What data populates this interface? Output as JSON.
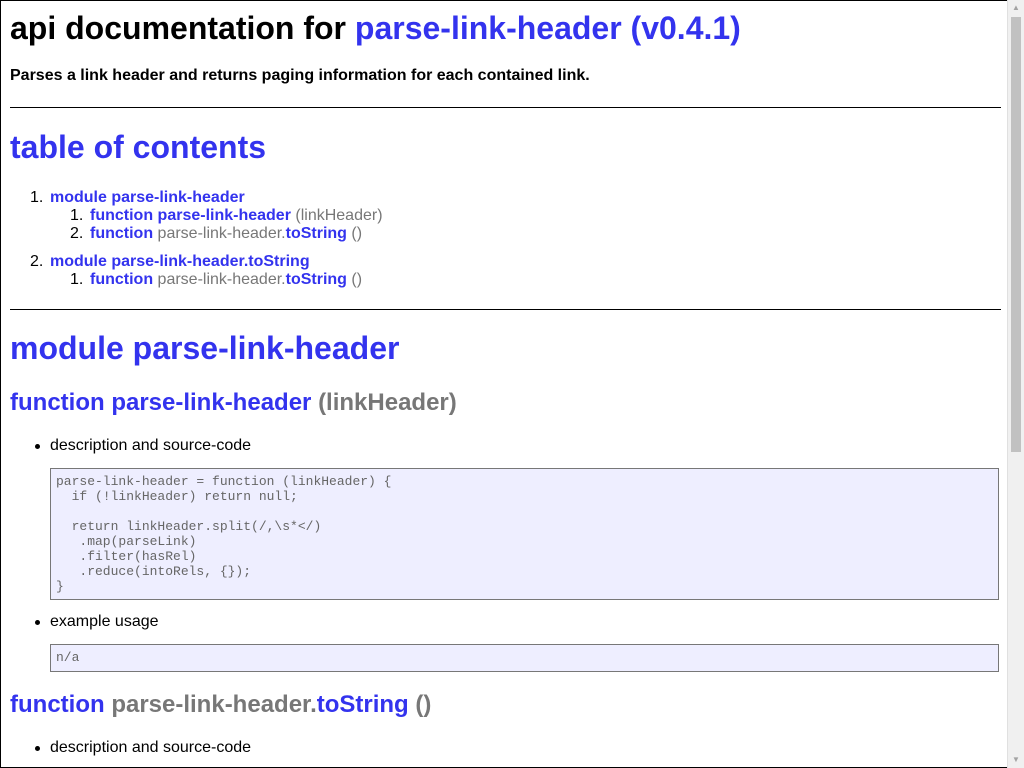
{
  "header": {
    "title_prefix": "api documentation for ",
    "title_link": "parse-link-header (v0.4.1)",
    "description": "Parses a link header and returns paging information for each contained link."
  },
  "toc": {
    "heading": "table of contents",
    "items": [
      {
        "num": "1.",
        "label": "module parse-link-header",
        "children": [
          {
            "num": "1.",
            "kw": "function",
            "name_link": "parse-link-header",
            "name_plain": "",
            "sig": "(linkHeader)"
          },
          {
            "num": "2.",
            "kw": "function",
            "name_plain": "parse-link-header.",
            "name_link": "toString",
            "sig": "()"
          }
        ]
      },
      {
        "num": "2.",
        "label": "module parse-link-header.toString",
        "children": [
          {
            "num": "1.",
            "kw": "function",
            "name_plain": "parse-link-header.",
            "name_link": "toString",
            "sig": "()"
          }
        ]
      }
    ]
  },
  "module": {
    "heading": "module parse-link-header",
    "functions": [
      {
        "kw": "function",
        "name_link": "parse-link-header",
        "sig": "(linkHeader)",
        "desc_label": "description and source-code",
        "source": "parse-link-header = function (linkHeader) {\n  if (!linkHeader) return null;\n\n  return linkHeader.split(/,\\s*</)\n   .map(parseLink)\n   .filter(hasRel)\n   .reduce(intoRels, {});\n}",
        "example_label": "example usage",
        "example": "n/a"
      },
      {
        "kw": "function",
        "name_plain": "parse-link-header.",
        "name_link": "toString",
        "sig": "()",
        "desc_label": "description and source-code"
      }
    ]
  }
}
